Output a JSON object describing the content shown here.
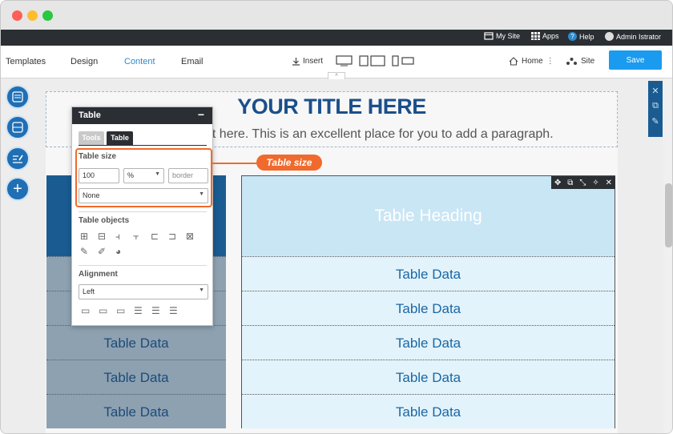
{
  "topbar": {
    "my_site": "My Site",
    "apps": "Apps",
    "help": "Help",
    "user": "Admin Istrator"
  },
  "nav": {
    "templates": "Templates",
    "design": "Design",
    "content": "Content",
    "email": "Email",
    "insert": "Insert",
    "home": "Home",
    "site": "Site",
    "save": "Save"
  },
  "page": {
    "title": "YOUR TITLE HERE",
    "paragraph": "nt here. This is an excellent place for you to add a paragraph."
  },
  "left_table": {
    "rows": [
      "Table Data",
      "Table Data",
      "Table Data"
    ]
  },
  "right_table": {
    "heading": "Table Heading",
    "rows": [
      "Table Data",
      "Table Data",
      "Table Data",
      "Table Data",
      "Table Data"
    ]
  },
  "panel": {
    "title": "Table",
    "minimize": "−",
    "tabs": [
      "Tools",
      "Table"
    ],
    "table_size_label": "Table size",
    "width_value": "100",
    "unit": "%",
    "border_placeholder": "border",
    "style_select": "None",
    "objects_label": "Table objects",
    "alignment_label": "Alignment",
    "alignment_value": "Left"
  },
  "callout": "Table size",
  "colors": {
    "accent": "#1a9bf0",
    "callout": "#f06a2d",
    "title_blue": "#1b4f8a",
    "dark_bar": "#2b2f33"
  }
}
